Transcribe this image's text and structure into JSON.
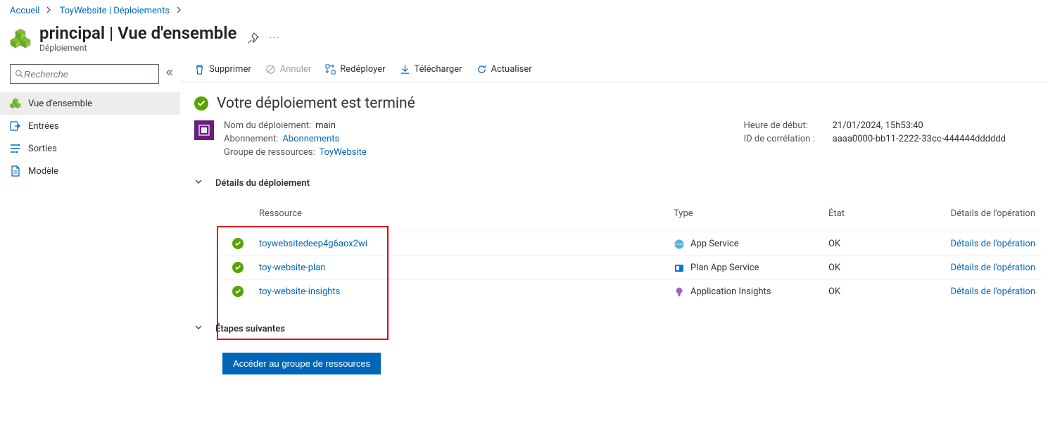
{
  "breadcrumb": {
    "home": "Accueil",
    "deployments": "ToyWebsite | Déploiements"
  },
  "header": {
    "title": "principal | Vue d'ensemble",
    "subtitle": "Déploiement"
  },
  "sidebar": {
    "search_placeholder": "Recherche",
    "items": [
      {
        "label": "Vue d'ensemble"
      },
      {
        "label": "Entrées"
      },
      {
        "label": "Sorties"
      },
      {
        "label": "Modèle"
      }
    ]
  },
  "toolbar": {
    "delete": "Supprimer",
    "cancel": "Annuler",
    "redeploy": "Redéployer",
    "download": "Télécharger",
    "refresh": "Actualiser"
  },
  "status": {
    "title": "Votre déploiement est terminé",
    "left": {
      "deploy_name_k": "Nom du déploiement:",
      "deploy_name_v": "main",
      "sub_k": "Abonnement:",
      "sub_v": "Abonnements",
      "rg_k": "Groupe de ressources:",
      "rg_v": "ToyWebsite"
    },
    "right": {
      "start_k": "Heure de début:",
      "start_v": "21/01/2024, 15h53:40",
      "corr_k": "ID de corrélation :",
      "corr_v": "aaaa0000-bb11-2222-33cc-444444dddddd"
    }
  },
  "sections": {
    "details_title": "Détails du déploiement",
    "next_title": "Étapes suivantes",
    "next_button": "Accéder au groupe de ressources"
  },
  "table": {
    "headers": {
      "resource": "Ressource",
      "type": "Type",
      "state": "État",
      "op": "Détails de l'opération"
    },
    "op_link": "Détails de l'opération",
    "rows": [
      {
        "resource": "toywebsitedeep4g6aox2wi",
        "type": "App Service",
        "state": "OK"
      },
      {
        "resource": "toy-website-plan",
        "type": "Plan App Service",
        "state": "OK"
      },
      {
        "resource": "toy-website-insights",
        "type": "Application Insights",
        "state": "OK"
      }
    ]
  }
}
